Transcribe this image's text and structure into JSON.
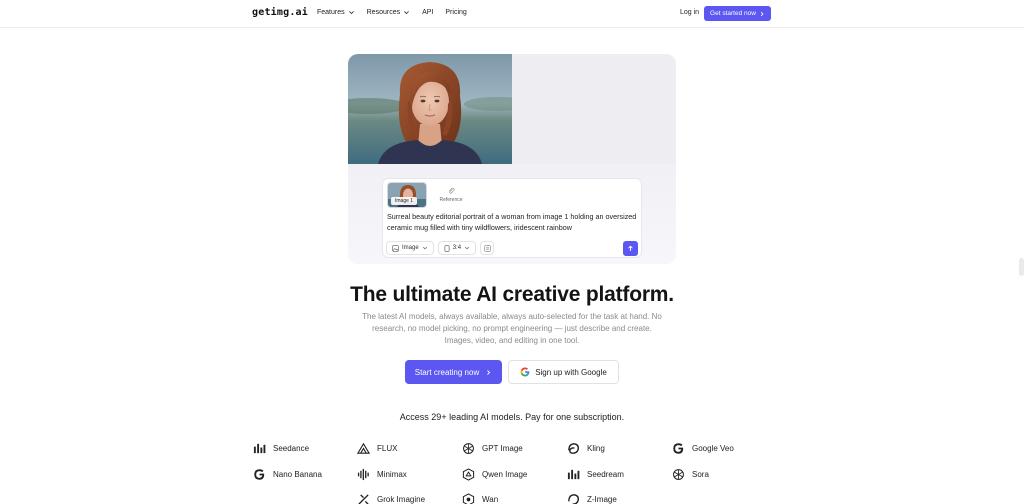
{
  "nav": {
    "logo": "getimg.ai",
    "links": [
      {
        "label": "Features",
        "has_dropdown": true
      },
      {
        "label": "Resources",
        "has_dropdown": true
      },
      {
        "label": "API",
        "has_dropdown": false
      },
      {
        "label": "Pricing",
        "has_dropdown": false
      }
    ],
    "login": "Log in",
    "cta": "Get started now"
  },
  "composer": {
    "image_tag": "Image 1",
    "reference_label": "Reference",
    "prompt": "Surreal beauty editorial portrait of a woman from image 1 holding an oversized ceramic mug filled with tiny wildflowers, iridescent rainbow",
    "mode": "Image",
    "ratio": "3:4"
  },
  "hero": {
    "headline": "The ultimate AI creative platform.",
    "subtext": "The latest AI models, always available, always auto-selected for the task at hand. No research, no model picking, no prompt engineering — just describe and create. Images, video, and editing in one tool.",
    "primary_cta": "Start creating now",
    "google_cta": "Sign up with Google"
  },
  "models": {
    "heading": "Access 29+ leading AI models. Pay for one subscription.",
    "items": [
      "Seedance",
      "FLUX",
      "GPT Image",
      "Kling",
      "Google Veo",
      "Nano Banana",
      "Minimax",
      "Qwen Image",
      "Seedream",
      "Sora",
      "Grok Imagine",
      "Wan",
      "Z-Image"
    ]
  },
  "colors": {
    "accent": "#5b57f0",
    "text": "#1a1a1a",
    "muted": "#8a8a8a"
  }
}
